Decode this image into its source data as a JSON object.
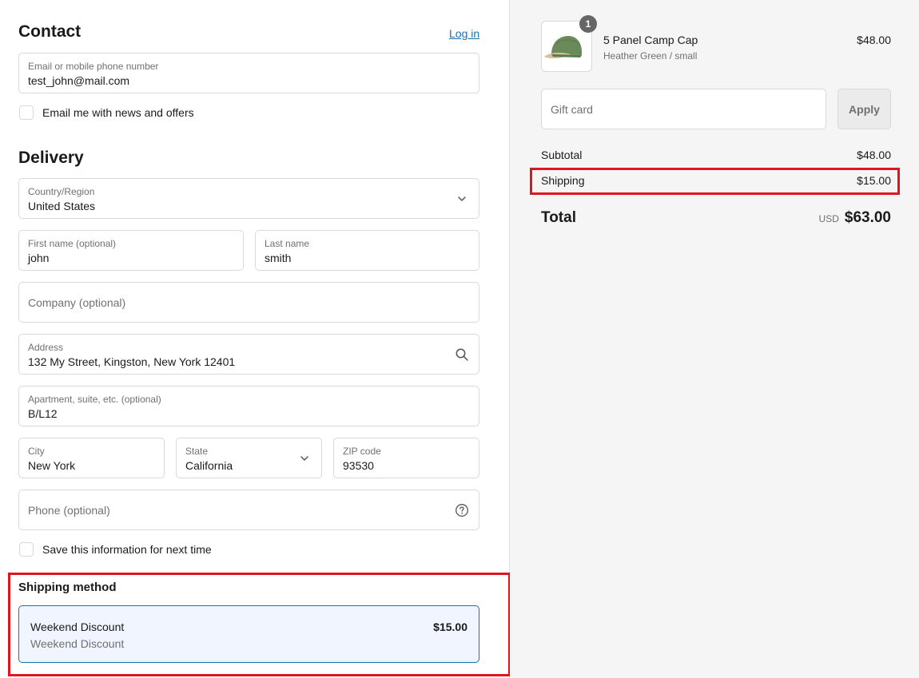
{
  "contact": {
    "title": "Contact",
    "login_link": "Log in",
    "email_label": "Email or mobile phone number",
    "email_value": "test_john@mail.com",
    "news_checkbox_label": "Email me with news and offers"
  },
  "delivery": {
    "title": "Delivery",
    "country_label": "Country/Region",
    "country_value": "United States",
    "first_name_label": "First name (optional)",
    "first_name_value": "john",
    "last_name_label": "Last name",
    "last_name_value": "smith",
    "company_placeholder": "Company (optional)",
    "address_label": "Address",
    "address_value": "132 My Street, Kingston, New York 12401",
    "apartment_label": "Apartment, suite, etc. (optional)",
    "apartment_value": "B/L12",
    "city_label": "City",
    "city_value": "New York",
    "state_label": "State",
    "state_value": "California",
    "zip_label": "ZIP code",
    "zip_value": "93530",
    "phone_placeholder": "Phone (optional)",
    "save_checkbox_label": "Save this information for next time"
  },
  "shipping_method": {
    "title": "Shipping method",
    "option_name": "Weekend Discount",
    "option_sub": "Weekend Discount",
    "option_price": "$15.00"
  },
  "summary": {
    "product": {
      "quantity": "1",
      "name": "5 Panel Camp Cap",
      "variant": "Heather Green / small",
      "price": "$48.00"
    },
    "gift_card_placeholder": "Gift card",
    "apply_label": "Apply",
    "subtotal_label": "Subtotal",
    "subtotal_value": "$48.00",
    "shipping_label": "Shipping",
    "shipping_value": "$15.00",
    "total_label": "Total",
    "total_currency": "USD",
    "total_value": "$63.00"
  },
  "colors": {
    "accent": "#1773b0",
    "highlight": "#e0161f",
    "selected_bg": "#f0f5ff"
  },
  "icons": [
    "chevron-down-icon",
    "search-icon",
    "help-circle-icon"
  ]
}
